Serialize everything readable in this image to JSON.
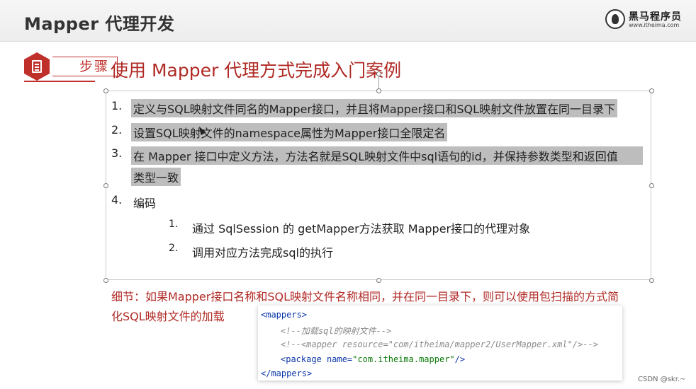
{
  "header": {
    "title": "Mapper 代理开发",
    "logo_name": "黑马程序员",
    "logo_url": "www.itheima.com"
  },
  "step": {
    "badge_label": "步骤",
    "heading": "使用 Mapper 代理方式完成入门案例"
  },
  "steps": [
    {
      "num": "1.",
      "text": "定义与SQL映射文件同名的Mapper接口，并且将Mapper接口和SQL映射文件放置在同一目录下"
    },
    {
      "num": "2.",
      "text": "设置SQL映射文件的namespace属性为Mapper接口全限定名"
    },
    {
      "num": "3.",
      "text_line1": "在 Mapper 接口中定义方法，方法名就是SQL映射文件中sql语句的id，并保持参数类型和返回值",
      "text_line2": "类型一致"
    },
    {
      "num": "4.",
      "text": "编码"
    }
  ],
  "substeps": [
    {
      "num": "1.",
      "text": "通过  SqlSession 的  getMapper方法获取  Mapper接口的代理对象"
    },
    {
      "num": "2.",
      "text": "调用对应方法完成sql的执行"
    }
  ],
  "note": {
    "line1": "细节：如果Mapper接口名称和SQL映射文件名称相同，并在同一目录下，则可以使用包扫描的方式简",
    "line2": "化SQL映射文件的加载"
  },
  "code": {
    "open_tag": "<mappers>",
    "comment1": "<!--加载sql的映射文件-->",
    "comment2": "<!--<mapper resource=\"com/itheima/mapper2/UserMapper.xml\"/>-->",
    "pkg_open": "<package",
    "pkg_attr": " name=",
    "pkg_value": "\"com.itheima.mapper\"",
    "pkg_close": "/>",
    "close_tag": "</mappers>"
  },
  "watermark": "CSDN @skr.~",
  "colors": {
    "accent_red": "#b02a25",
    "badge_red": "#c0302b",
    "highlight_gray": "#bdbdbd",
    "xml_tag_blue": "#0b35a8",
    "xml_string_green": "#0a7a0a"
  }
}
